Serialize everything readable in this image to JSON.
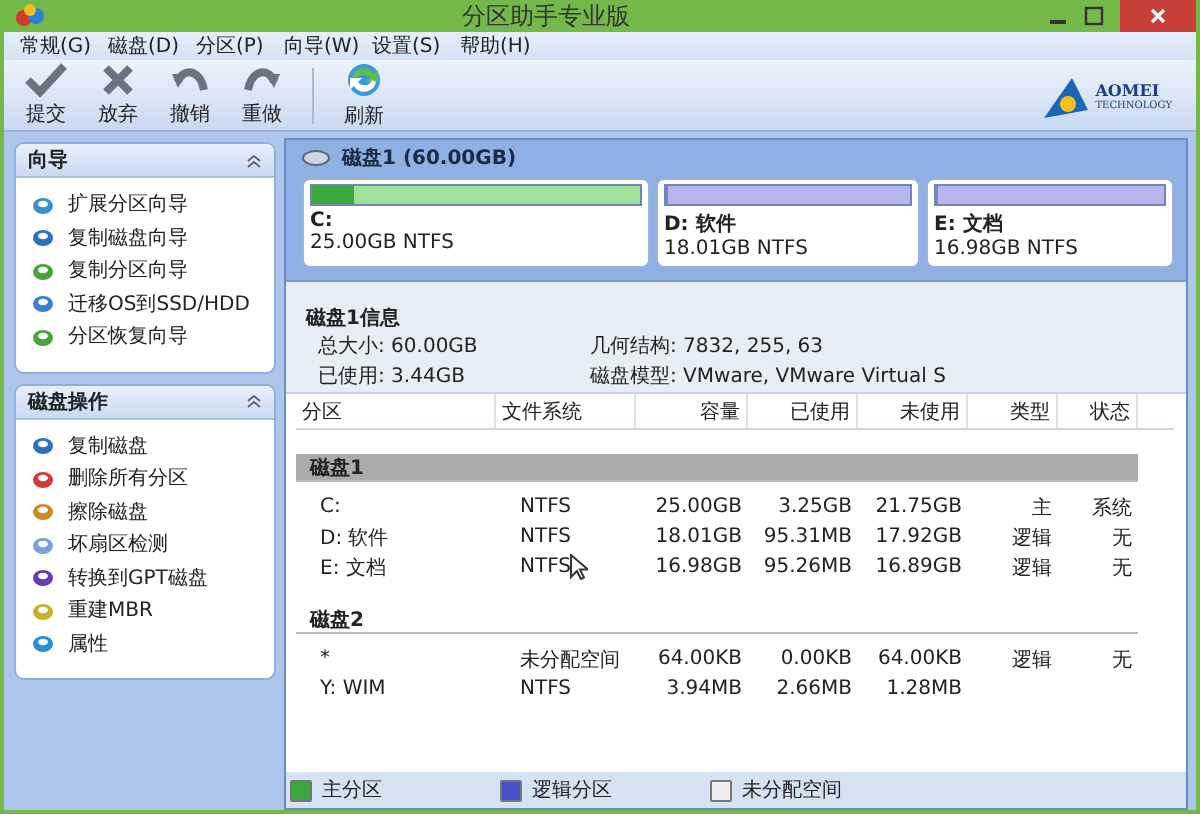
{
  "window": {
    "title": "分区助手专业版"
  },
  "menu": [
    "常规(G)",
    "磁盘(D)",
    "分区(P)",
    "向导(W)",
    "设置(S)",
    "帮助(H)"
  ],
  "toolbar": [
    {
      "label": "提交"
    },
    {
      "label": "放弃"
    },
    {
      "label": "撤销"
    },
    {
      "label": "重做"
    },
    {
      "label": "刷新"
    }
  ],
  "logo": {
    "name": "AOMEI",
    "tagline": "TECHNOLOGY"
  },
  "sidebar": [
    {
      "title": "向导",
      "expanded": true,
      "items": [
        "扩展分区向导",
        "复制磁盘向导",
        "复制分区向导",
        "迁移OS到SSD/HDD",
        "分区恢复向导"
      ]
    },
    {
      "title": "磁盘操作",
      "expanded": true,
      "items": [
        "复制磁盘",
        "删除所有分区",
        "擦除磁盘",
        "坏扇区检测",
        "转换到GPT磁盘",
        "重建MBR",
        "属性"
      ]
    }
  ],
  "disk_map": {
    "title": "磁盘1 (60.00GB)",
    "partitions": [
      {
        "name": "C:",
        "detail": "25.00GB NTFS",
        "kind": "primary",
        "level": 0.13
      },
      {
        "name": "D: 软件",
        "detail": "18.01GB NTFS",
        "kind": "logical",
        "level": 0.01
      },
      {
        "name": "E: 文档",
        "detail": "16.98GB NTFS",
        "kind": "logical",
        "level": 0.01
      }
    ]
  },
  "disk_info": {
    "title": "磁盘1信息",
    "fields": [
      "总大小: 60.00GB",
      "几何结构: 7832, 255, 63",
      "已使用: 3.44GB",
      "磁盘模型: VMware, VMware Virtual S"
    ]
  },
  "table": {
    "columns": [
      "分区",
      "文件系统",
      "容量",
      "已使用",
      "未使用",
      "类型",
      "状态"
    ],
    "groups": [
      {
        "title": "磁盘1",
        "selected": true,
        "rows": [
          [
            "C:",
            "NTFS",
            "25.00GB",
            "3.25GB",
            "21.75GB",
            "主",
            "系统"
          ],
          [
            "D: 软件",
            "NTFS",
            "18.01GB",
            "95.31MB",
            "17.92GB",
            "逻辑",
            "无"
          ],
          [
            "E: 文档",
            "NTFS",
            "16.98GB",
            "95.26MB",
            "16.89GB",
            "逻辑",
            "无"
          ]
        ]
      },
      {
        "title": "磁盘2",
        "selected": false,
        "rows": [
          [
            "*",
            "未分配空间",
            "64.00KB",
            "0.00KB",
            "64.00KB",
            "逻辑",
            "无"
          ],
          [
            "Y: WIM",
            "NTFS",
            "3.94MB",
            "2.66MB",
            "1.28MB"
          ]
        ]
      }
    ]
  },
  "legend": [
    {
      "label": "主分区",
      "color": "#3aa83a"
    },
    {
      "label": "逻辑分区",
      "color": "#4a4ec8"
    },
    {
      "label": "未分配空间",
      "color": "#eeeeee"
    }
  ]
}
